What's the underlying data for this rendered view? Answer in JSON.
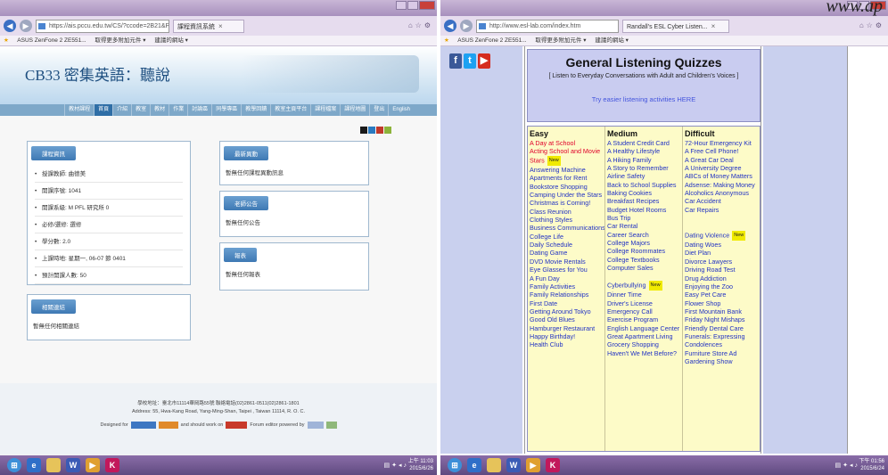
{
  "watermark": "www.ap",
  "left": {
    "browser": {
      "address": "https://ais.pccu.edu.tw/CS/?ccode=2B21&PH",
      "tab_title": "課程資訊系統",
      "favorites": [
        "ASUS ZenFone 2 ZE551...",
        "取得更多附加元件 ▾",
        "建議的網站 ▾"
      ]
    },
    "site_title": "CB33 密集英語：聽說",
    "nav": [
      "教材課程",
      "首頁",
      "介紹",
      "教室",
      "教材",
      "作業",
      "討論區",
      "同學專區",
      "教學回饋",
      "教室主頁平台",
      "課程檔案",
      "課程地圖",
      "登出",
      "English"
    ],
    "nav_active": 1,
    "swatch_colors": [
      "#1a1a1a",
      "#2a7ac0",
      "#c0392b",
      "#8db33a"
    ],
    "course_info": {
      "title": "課程資訊",
      "items": [
        "授課教師: 曲德美",
        "開課序號: 1041",
        "開課系級: M PFL 研究所 0",
        "必修/選修: 選修",
        "學分數: 2.0",
        "上課時地: 星期一, 06-07 節 0401",
        "預計開課人數: 50"
      ]
    },
    "related_links": {
      "title": "相關連結",
      "text": "暫無任何相關連結"
    },
    "latest_news": {
      "title": "最新異動",
      "text": "暫無任何課程異動訊息"
    },
    "teacher_notice": {
      "title": "老師公告",
      "text": "暫無任何公告"
    },
    "report": {
      "title": "報表",
      "text": "暫無任何報表"
    },
    "footer": {
      "line1": "學校地址：臺北市11114華岡路55號  聯絡電話(02)2861-0511(02)2861-1801",
      "line2": "Address: 55, Hwa-Kang Road, Yang-Ming-Shan, Taipei , Taiwan 11114, R. O. C.",
      "designed_for": "Designed for",
      "should_work": "and should work on",
      "forum_editor": "Forum editor powered by"
    },
    "clock": {
      "time": "上午 11:03",
      "date": "2015/6/26"
    }
  },
  "right": {
    "browser": {
      "address": "http://www.esl-lab.com/index.htm",
      "tab_title": "Randall's ESL Cyber Listen...",
      "favorites": [
        "ASUS ZenFone 2 ZE551...",
        "取得更多附加元件 ▾",
        "建議的網站 ▾"
      ]
    },
    "social": [
      "f",
      "t",
      "▶"
    ],
    "heading": "General Listening Quizzes",
    "subheading": "[ Listen to Everyday Conversations with Adult and Children's Voices ]",
    "easier_link": "Try easier listening activities HERE",
    "new_label": "New",
    "columns": [
      {
        "title": "Easy",
        "items": [
          {
            "t": "A Day at School",
            "red": true
          },
          {
            "t": "Acting School and Movie",
            "red": true
          },
          {
            "t": "Stars",
            "red": true,
            "new": true
          },
          {
            "t": "Answering Machine"
          },
          {
            "t": "Apartments for Rent"
          },
          {
            "t": "Bookstore Shopping"
          },
          {
            "t": "Camping Under the Stars"
          },
          {
            "t": "Christmas is Coming!"
          },
          {
            "t": "Class Reunion"
          },
          {
            "t": "Clothing Styles"
          },
          {
            "t": "Business Communications"
          },
          {
            "t": "College Life"
          },
          {
            "t": "Daily Schedule"
          },
          {
            "t": "Dating Game"
          },
          {
            "t": "DVD Movie Rentals"
          },
          {
            "t": "Eye Glasses for You"
          },
          {
            "t": "A Fun Day"
          },
          {
            "t": "Family Activities"
          },
          {
            "t": "Family Relationships"
          },
          {
            "t": "First Date"
          },
          {
            "t": "Getting Around Tokyo"
          },
          {
            "t": "Good Old Blues"
          },
          {
            "t": "Hamburger Restaurant"
          },
          {
            "t": "Happy Birthday!"
          },
          {
            "t": "Health Club"
          }
        ]
      },
      {
        "title": "Medium",
        "items": [
          {
            "t": "A Student Credit Card"
          },
          {
            "t": "A Healthy Lifestyle"
          },
          {
            "t": "A Hiking Family"
          },
          {
            "t": "A Story to Remember"
          },
          {
            "t": "Airline Safety"
          },
          {
            "t": "Back to School Supplies"
          },
          {
            "t": "Baking Cookies"
          },
          {
            "t": "Breakfast Recipes"
          },
          {
            "t": "Budget Hotel Rooms"
          },
          {
            "t": "Bus Trip"
          },
          {
            "t": "Car Rental"
          },
          {
            "t": "Career Search"
          },
          {
            "t": "College Majors"
          },
          {
            "t": "College Roommates"
          },
          {
            "t": "College Textbooks"
          },
          {
            "t": "Computer Sales"
          },
          {
            "t": ""
          },
          {
            "t": "Cyberbullying",
            "new": true
          },
          {
            "t": "Dinner Time"
          },
          {
            "t": "Driver's License"
          },
          {
            "t": "Emergency Call"
          },
          {
            "t": "Exercise Program"
          },
          {
            "t": "English Language Center"
          },
          {
            "t": "Great Apartment Living"
          },
          {
            "t": "Grocery Shopping"
          },
          {
            "t": "Haven't We Met Before?"
          }
        ]
      },
      {
        "title": "Difficult",
        "items": [
          {
            "t": "72-Hour Emergency Kit"
          },
          {
            "t": "A Free Cell Phone!"
          },
          {
            "t": "A Great Car Deal"
          },
          {
            "t": "A University Degree"
          },
          {
            "t": "ABCs of Money Matters"
          },
          {
            "t": "Adsense: Making Money"
          },
          {
            "t": "Alcoholics Anonymous"
          },
          {
            "t": "Car Accident"
          },
          {
            "t": "Car Repairs"
          },
          {
            "t": ""
          },
          {
            "t": ""
          },
          {
            "t": "Dating Violence",
            "new": true
          },
          {
            "t": "Dating Woes"
          },
          {
            "t": "Diet Plan"
          },
          {
            "t": "Divorce Lawyers"
          },
          {
            "t": "Driving Road Test"
          },
          {
            "t": "Drug Addiction"
          },
          {
            "t": "Enjoying the Zoo"
          },
          {
            "t": "Easy Pet Care"
          },
          {
            "t": "Flower Shop"
          },
          {
            "t": "First Mountain Bank"
          },
          {
            "t": "Friday Night Mishaps"
          },
          {
            "t": "Friendly Dental Care"
          },
          {
            "t": "Funerals: Expressing"
          },
          {
            "t": "Condolences"
          },
          {
            "t": "Furniture Store Ad"
          },
          {
            "t": "Gardening Show"
          }
        ]
      }
    ],
    "clock": {
      "time": "下午 01:56",
      "date": "2015/6/24"
    }
  }
}
